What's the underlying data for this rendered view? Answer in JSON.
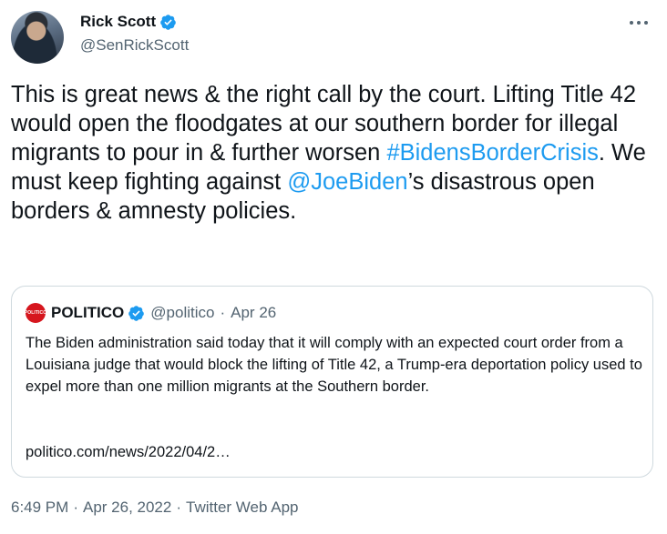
{
  "tweet": {
    "author_name": "Rick Scott",
    "author_handle": "@SenRickScott",
    "text_part1": "This is great news & the right call by the court. Lifting Title 42 would open the floodgates at our southern border for illegal migrants to pour in & further worsen ",
    "hashtag": "#BidensBorderCrisis",
    "text_part2": ". We must keep fighting against ",
    "mention": "@JoeBiden",
    "text_part3": "’s disastrous open borders & amnesty policies.",
    "time": "6:49 PM",
    "date": "Apr 26, 2022",
    "source": "Twitter Web App",
    "separator": "·"
  },
  "quote": {
    "avatar_text": "POLITICO",
    "author_name": "POLITICO",
    "author_handle": "@politico",
    "separator": "·",
    "date": "Apr 26",
    "text": "The Biden administration said today that it will comply with an expected court order from a Louisiana judge that would block the lifting of Title 42, a Trump-era deportation policy used to expel more than one million migrants at the Southern border.",
    "link": "politico.com/news/2022/04/2…"
  },
  "colors": {
    "accent": "#1d9bf0",
    "text": "#0f1419",
    "secondary": "#536471",
    "border": "#cfd9de",
    "politico_red": "#d6161e"
  },
  "icons": {
    "verified": "verified-badge-icon",
    "more": "more-horizontal-icon"
  }
}
